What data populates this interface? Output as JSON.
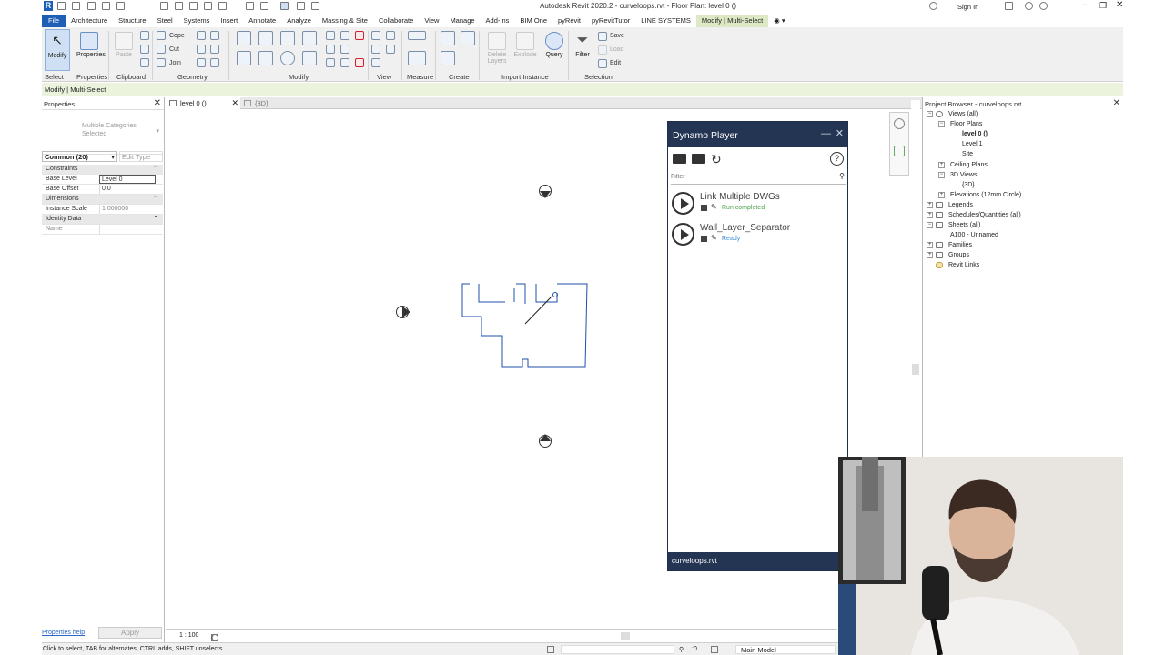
{
  "window": {
    "title": "Autodesk Revit 2020.2 - curveloops.rvt - Floor Plan: level 0 ()",
    "sign_in": "Sign In"
  },
  "ribbon_tabs": [
    "File",
    "Architecture",
    "Structure",
    "Steel",
    "Systems",
    "Insert",
    "Annotate",
    "Analyze",
    "Massing & Site",
    "Collaborate",
    "View",
    "Manage",
    "Add-Ins",
    "BIM One",
    "pyRevit",
    "pyRevitTutor",
    "LINE SYSTEMS",
    "Modify | Multi-Select"
  ],
  "ribbon": {
    "modify": "Modify",
    "properties": "Properties",
    "paste": "Paste",
    "cope": "Cope",
    "cut": "Cut",
    "join": "Join",
    "delete_layers": "Delete Layers",
    "explode": "Explode",
    "query": "Query",
    "filter": "Filter",
    "save": "Save",
    "load": "Load",
    "edit": "Edit",
    "panels": [
      "Select",
      "Properties",
      "Clipboard",
      "Geometry",
      "Modify",
      "View",
      "Measure",
      "Create",
      "Import Instance",
      "Selection"
    ]
  },
  "options_bar": {
    "text": "Modify | Multi-Select"
  },
  "properties": {
    "header": "Properties",
    "type_selector": "Multiple Categories Selected",
    "filter_label": "Common (20)",
    "edit_type": "Edit Type",
    "groups": {
      "constraints": "Constraints",
      "dimensions": "Dimensions",
      "identity": "Identity Data"
    },
    "rows": {
      "base_level_label": "Base Level",
      "base_level_value": "Level 0",
      "base_offset_label": "Base Offset",
      "base_offset_value": "0.0",
      "instance_scale_label": "Instance Scale",
      "instance_scale_value": "1.000000",
      "name_label": "Name",
      "name_value": ""
    },
    "help_link": "Properties help",
    "apply": "Apply"
  },
  "view_tabs": [
    {
      "label": "level 0 ()",
      "active": true
    },
    {
      "label": "{3D}",
      "active": false
    }
  ],
  "view_control": {
    "scale": "1 : 100"
  },
  "project_browser": {
    "title": "Project Browser - curveloops.rvt",
    "items": {
      "views": "Views (all)",
      "floor_plans": "Floor Plans",
      "level0": "level 0 ()",
      "level1": "Level 1",
      "site": "Site",
      "ceiling_plans": "Ceiling Plans",
      "views_3d": "3D Views",
      "view_3d": "{3D}",
      "elevations": "Elevations (12mm Circle)",
      "legends": "Legends",
      "schedules": "Schedules/Quantities (all)",
      "sheets": "Sheets (all)",
      "sheet_a100": "A100 - Unnamed",
      "families": "Families",
      "groups": "Groups",
      "revit_links": "Revit Links"
    }
  },
  "dynamo_player": {
    "title": "Dynamo Player",
    "filter_placeholder": "Filter",
    "scripts": [
      {
        "name": "Link Multiple DWGs",
        "status": "Run completed"
      },
      {
        "name": "Wall_Layer_Separator",
        "status": "Ready"
      }
    ],
    "footer": "curveloops.rvt"
  },
  "status_bar": {
    "hint": "Click to select, TAB for alternates, CTRL adds, SHIFT unselects.",
    "selection_count": ":0",
    "model": "Main Model"
  },
  "colors": {
    "file_tab": "#1e5fb5",
    "contextual_tab": "#dde8c4",
    "dynamo_header": "#243554",
    "run_completed": "#4aa24a",
    "ready": "#3a8ed6"
  }
}
